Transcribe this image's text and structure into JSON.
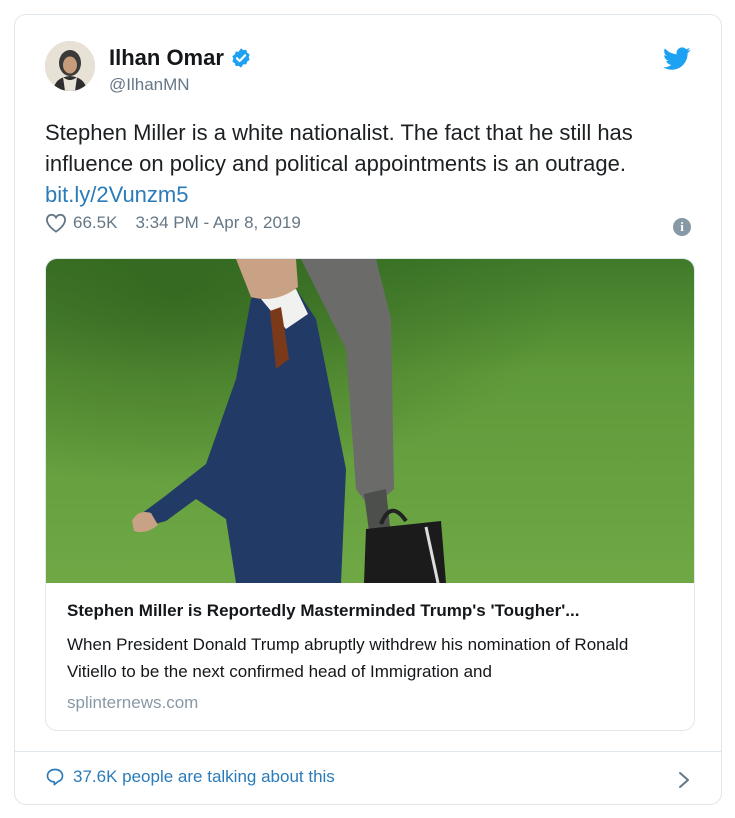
{
  "user": {
    "name": "Ilhan Omar",
    "handle": "@IlhanMN",
    "avatar_icon": "user-avatar"
  },
  "tweet": {
    "text": "Stephen Miller is a white nationalist. The fact that he still has influence on policy and political appointments is an outrage.",
    "link": "bit.ly/2Vunzm5",
    "likes": "66.5K",
    "timestamp": "3:34 PM - Apr 8, 2019"
  },
  "preview": {
    "title": "Stephen Miller is Reportedly Masterminded Trump's 'Tougher'...",
    "description": "When President Donald Trump abruptly withdrew his nomination of Ronald Vitiello to be the next confirmed head of Immigration and",
    "domain": "splinternews.com"
  },
  "footer": {
    "talking": "37.6K people are talking about this"
  },
  "colors": {
    "brand": "#1da1f2",
    "link": "#2b7bb9",
    "muted": "#657786"
  }
}
